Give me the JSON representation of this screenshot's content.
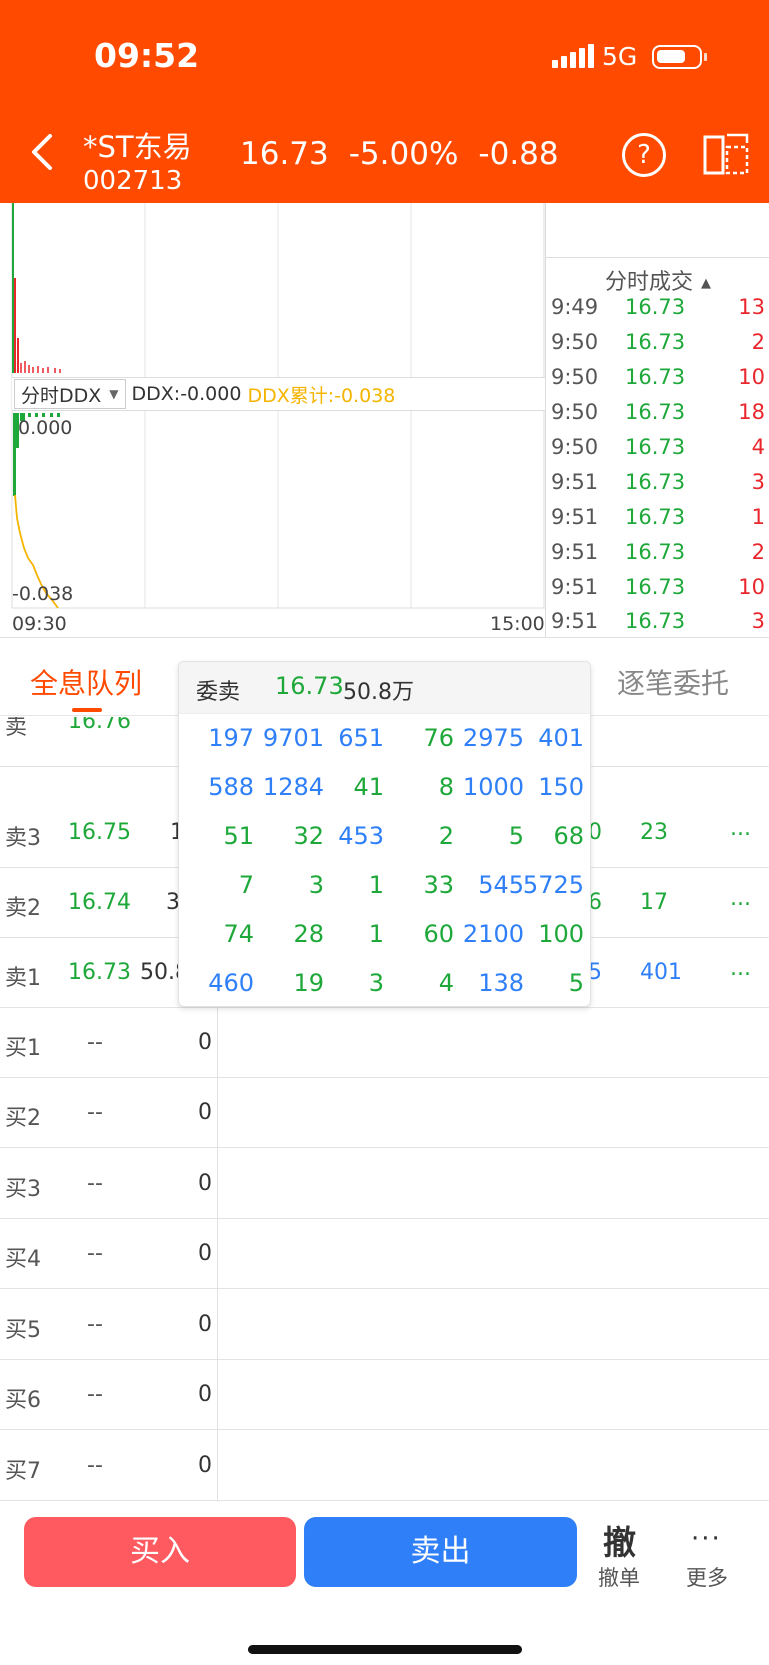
{
  "status": {
    "time": "09:52",
    "network": "5G"
  },
  "header": {
    "name": "*ST东易",
    "code": "002713",
    "price": "16.73",
    "change_pct": "-5.00%",
    "change_abs": "-0.88",
    "help_label": "?"
  },
  "colors": {
    "brand": "#FF4A00",
    "up": "#E8262C",
    "down": "#1EA83A",
    "blue": "#2F7FF8",
    "ddx_cum": "#F5B400"
  },
  "chart": {
    "ddx_selector": "分时DDX",
    "ddx_value": "DDX:-0.000",
    "ddx_cum": "DDX累计:-0.038",
    "y_top": "0.000",
    "y_bottom": "-0.038",
    "x_start": "09:30",
    "x_end": "15:00"
  },
  "ticks": {
    "title": "分时成交",
    "rows": [
      {
        "time": "9:49",
        "price": "16.73",
        "vol": "13"
      },
      {
        "time": "9:50",
        "price": "16.73",
        "vol": "2"
      },
      {
        "time": "9:50",
        "price": "16.73",
        "vol": "10"
      },
      {
        "time": "9:50",
        "price": "16.73",
        "vol": "18"
      },
      {
        "time": "9:50",
        "price": "16.73",
        "vol": "4"
      },
      {
        "time": "9:51",
        "price": "16.73",
        "vol": "3"
      },
      {
        "time": "9:51",
        "price": "16.73",
        "vol": "1"
      },
      {
        "time": "9:51",
        "price": "16.73",
        "vol": "2"
      },
      {
        "time": "9:51",
        "price": "16.73",
        "vol": "10"
      },
      {
        "time": "9:51",
        "price": "16.73",
        "vol": "3"
      }
    ]
  },
  "tabs": {
    "left": "全息队列",
    "right": "逐笔委托"
  },
  "sell_rows": [
    {
      "label": "卖3",
      "price": "16.75",
      "vol": "1",
      "ex1": "0",
      "ex2": "23",
      "more": "..."
    },
    {
      "label": "卖2",
      "price": "16.74",
      "vol": "3",
      "ex1": "6",
      "ex2": "17",
      "more": "..."
    },
    {
      "label": "卖1",
      "price": "16.73",
      "vol": "50.8",
      "ex1": "5",
      "ex2": "401",
      "more": "..."
    }
  ],
  "partial_top": {
    "price": "16.76"
  },
  "buy_rows": [
    {
      "label": "买1",
      "price": "--",
      "vol": "0"
    },
    {
      "label": "买2",
      "price": "--",
      "vol": "0"
    },
    {
      "label": "买3",
      "price": "--",
      "vol": "0"
    },
    {
      "label": "买4",
      "price": "--",
      "vol": "0"
    },
    {
      "label": "买5",
      "price": "--",
      "vol": "0"
    },
    {
      "label": "买6",
      "price": "--",
      "vol": "0"
    },
    {
      "label": "买7",
      "price": "--",
      "vol": "0"
    }
  ],
  "popup": {
    "title": "委卖",
    "price": "16.73",
    "amount": "50.8万",
    "grid": [
      [
        "197",
        "9701",
        "651",
        "76",
        "2975",
        "401"
      ],
      [
        "588",
        "1284",
        "41",
        "8",
        "1000",
        "150"
      ],
      [
        "51",
        "32",
        "453",
        "2",
        "5",
        "68"
      ],
      [
        "7",
        "3",
        "1",
        "33",
        "545",
        "5725"
      ],
      [
        "74",
        "28",
        "1",
        "60",
        "2100",
        "100"
      ],
      [
        "460",
        "19",
        "3",
        "4",
        "138",
        "5"
      ]
    ],
    "grid_colors": [
      [
        "blue",
        "blue",
        "blue",
        "green",
        "blue",
        "blue"
      ],
      [
        "blue",
        "blue",
        "green",
        "green",
        "blue",
        "blue"
      ],
      [
        "green",
        "green",
        "blue",
        "green",
        "green",
        "green"
      ],
      [
        "green",
        "green",
        "green",
        "green",
        "blue",
        "blue"
      ],
      [
        "green",
        "green",
        "green",
        "green",
        "blue",
        "green"
      ],
      [
        "blue",
        "green",
        "green",
        "green",
        "blue",
        "green"
      ]
    ]
  },
  "bottom": {
    "buy": "买入",
    "sell": "卖出",
    "cancel_icon": "撤",
    "cancel": "撤单",
    "more_icon": "···",
    "more": "更多"
  }
}
